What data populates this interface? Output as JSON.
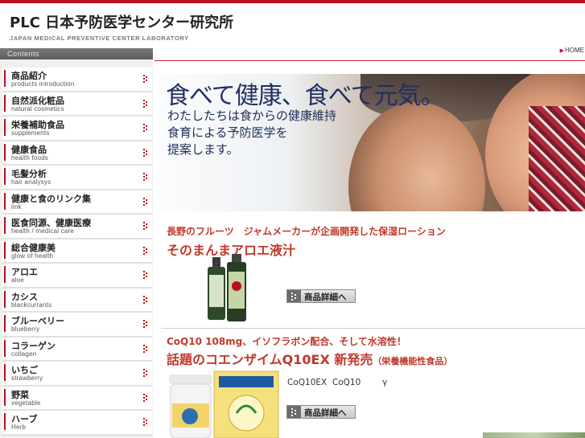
{
  "header": {
    "logo_title": "PLC 日本予防医学センター研究所",
    "logo_subtitle": "JAPAN MEDICAL PREVENTIVE CENTER LABORATORY",
    "home_link": "HOME"
  },
  "sidebar": {
    "heading": "Contents",
    "items": [
      {
        "jp": "商品紹介",
        "en": "products introduction"
      },
      {
        "jp": "自然派化粧品",
        "en": "natural cosmetics"
      },
      {
        "jp": "栄養補助食品",
        "en": "supplements"
      },
      {
        "jp": "健康食品",
        "en": "health foods"
      },
      {
        "jp": "毛髪分析",
        "en": "hair analysys"
      },
      {
        "jp": "健康と食のリンク集",
        "en": "link"
      },
      {
        "jp": "医食同源、健康医療",
        "en": "health / medical care"
      },
      {
        "jp": "総合健康美",
        "en": "glow of health"
      },
      {
        "jp": "アロエ",
        "en": "aloe"
      },
      {
        "jp": "カシス",
        "en": "blackcurrants"
      },
      {
        "jp": "ブルーベリー",
        "en": "blueberry"
      },
      {
        "jp": "コラーゲン",
        "en": "collagen"
      },
      {
        "jp": "いちご",
        "en": "strawberry"
      },
      {
        "jp": "野菜",
        "en": "vegetable"
      },
      {
        "jp": "ハーブ",
        "en": "Herb"
      }
    ]
  },
  "hero": {
    "headline": "食べて健康、食べて元気。",
    "body": "わたしたちは食からの健康維持\n食育による予防医学を\n提案します。"
  },
  "promo1": {
    "subtitle": "長野のフルーツ　ジャムメーカーが企画開発した保湿ローション",
    "title": "そのまんまアロエ液汁",
    "button": "商品詳細へ"
  },
  "promo2": {
    "subtitle": "CoQ10 108mg、イソフラボン配合、そして水溶性！",
    "title": "話題のコエンザイムQ10EX 新発売",
    "note": "（栄養機能性食品）",
    "description": "CoQ10EX  CoQ10        γ",
    "button": "商品詳細へ"
  },
  "colors": {
    "accent": "#b5121b",
    "promo_red": "#c0392b",
    "hero_text": "#223060"
  }
}
